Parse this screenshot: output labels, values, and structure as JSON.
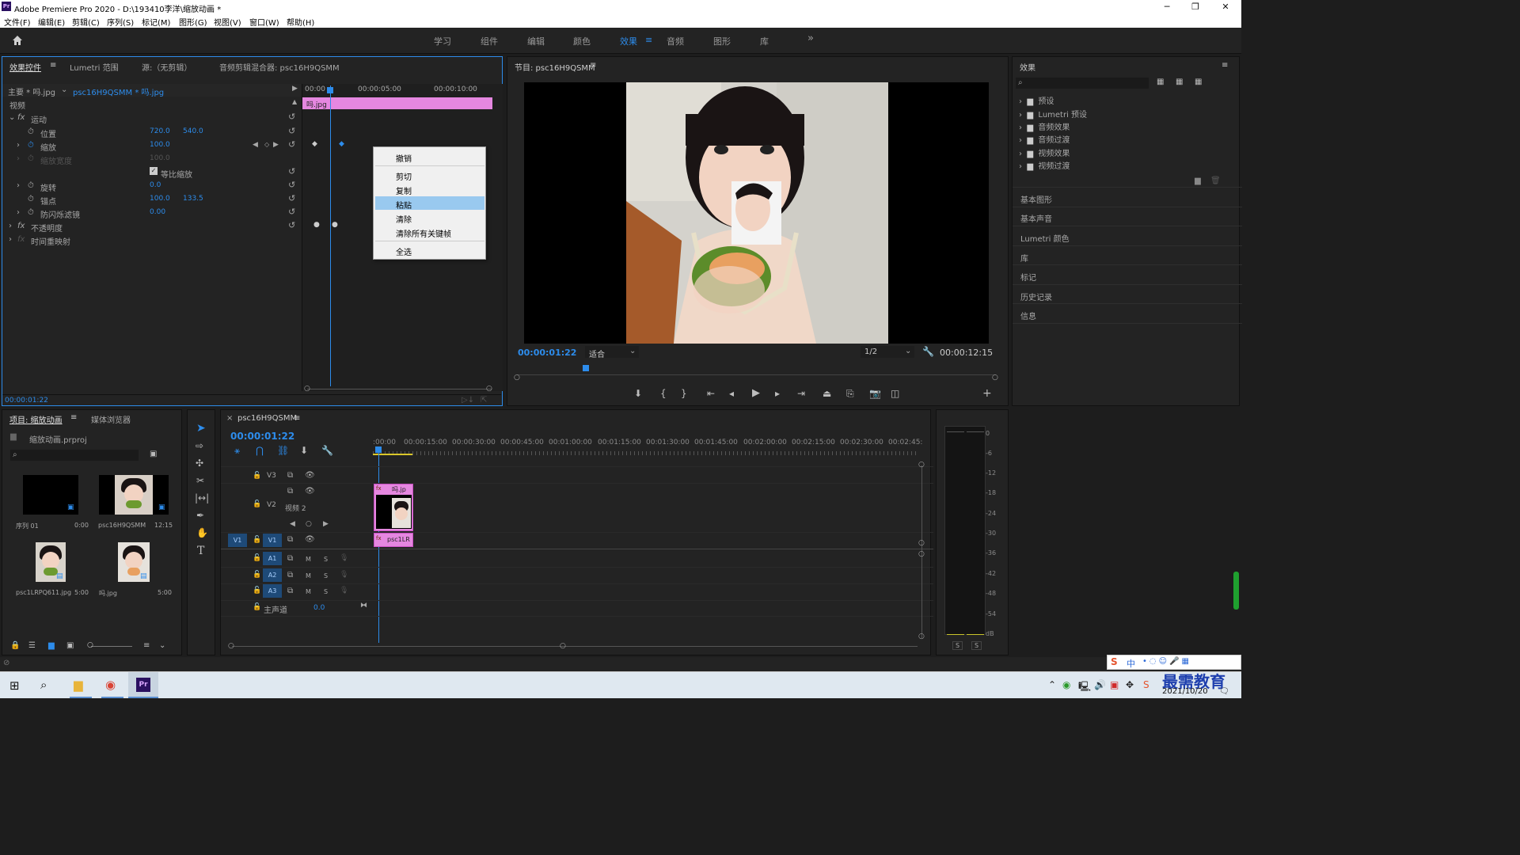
{
  "window": {
    "title": "Adobe Premiere Pro 2020 - D:\\193410李洋\\缩放动画 *",
    "app_icon": "Pr",
    "controls": [
      "─",
      "❐",
      "✕"
    ]
  },
  "menubar": [
    "文件(F)",
    "编辑(E)",
    "剪辑(C)",
    "序列(S)",
    "标记(M)",
    "图形(G)",
    "视图(V)",
    "窗口(W)",
    "帮助(H)"
  ],
  "workspaces": {
    "tabs": [
      "学习",
      "组件",
      "编辑",
      "颜色",
      "效果",
      "音频",
      "图形",
      "库"
    ],
    "active": "效果",
    "more": "»"
  },
  "effect_controls": {
    "tabs": [
      "效果控件",
      "Lumetri 范围",
      "源:（无剪辑）",
      "音频剪辑混合器: psc16H9QSMM"
    ],
    "master": "主要 * 吗.jpg",
    "clip": "psc16H9QSMM * 吗.jpg",
    "ruler": [
      "00:00",
      "00:00:05:00",
      "00:00:10:00"
    ],
    "clip_bar_label": "吗.jpg",
    "section_video": "视频",
    "motion": "运动",
    "position_label": "位置",
    "position_x": "720.0",
    "position_y": "540.0",
    "scale_label": "缩放",
    "scale_value": "100.0",
    "scale_width_label": "缩放宽度",
    "scale_width_value": "100.0",
    "uniform_label": "等比缩放",
    "rotation_label": "旋转",
    "rotation_value": "0.0",
    "anchor_label": "锚点",
    "anchor_x": "100.0",
    "anchor_y": "133.5",
    "flicker_label": "防闪烁滤镜",
    "flicker_value": "0.00",
    "opacity_label": "不透明度",
    "time_remap_label": "时间重映射",
    "timecode": "00:00:01:22"
  },
  "context_menu": {
    "items": [
      "撤销",
      "剪切",
      "复制",
      "粘贴",
      "清除",
      "清除所有关键帧",
      "全选"
    ],
    "highlighted": "粘贴"
  },
  "program_monitor": {
    "title": "节目: psc16H9QSMM",
    "timecode": "00:00:01:22",
    "fit": "适合",
    "resolution": "1/2",
    "duration": "00:00:12:15"
  },
  "effects_panel": {
    "title": "效果",
    "folders": [
      "预设",
      "Lumetri 预设",
      "音频效果",
      "音频过渡",
      "视频效果",
      "视频过渡"
    ],
    "sections": [
      "基本图形",
      "基本声音",
      "Lumetri 颜色",
      "库",
      "标记",
      "历史记录",
      "信息"
    ]
  },
  "project": {
    "tabs": [
      "项目: 缩放动画",
      "媒体浏览器"
    ],
    "file": "缩放动画.prproj",
    "items": [
      {
        "name": "序列 01",
        "dur": "0:00"
      },
      {
        "name": "psc16H9QSMM",
        "dur": "12:15"
      },
      {
        "name": "psc1LRPQ611.jpg",
        "dur": "5:00"
      },
      {
        "name": "吗.jpg",
        "dur": "5:00"
      }
    ]
  },
  "timeline": {
    "tab": "psc16H9QSMM",
    "timecode": "00:00:01:22",
    "ruler": [
      ":00:00",
      "00:00:15:00",
      "00:00:30:00",
      "00:00:45:00",
      "00:01:00:00",
      "00:01:15:00",
      "00:01:30:00",
      "00:01:45:00",
      "00:02:00:00",
      "00:02:15:00",
      "00:02:30:00",
      "00:02:45:"
    ],
    "tracks": [
      "V3",
      "V2",
      "V1",
      "A1",
      "A2",
      "A3"
    ],
    "v2_name": "视频 2",
    "master_label": "主声道",
    "master_value": "0.0",
    "clip_v2": "吗.jp",
    "clip_v1": "psc1LR",
    "m": "M",
    "s": "S"
  },
  "audio_meter": {
    "scale": [
      "0",
      "-6",
      "-12",
      "-18",
      "-24",
      "-30",
      "-36",
      "-42",
      "-48",
      "-54",
      "dB"
    ],
    "solo": [
      "S",
      "S"
    ]
  },
  "taskbar": {
    "date": "2021/10/20",
    "watermark": "最需教育",
    "ime": "中"
  },
  "colors": {
    "accent": "#2d8ceb",
    "clip_pink": "#e587e0",
    "panel": "#232323",
    "menu_highlight": "#99c9ef"
  }
}
